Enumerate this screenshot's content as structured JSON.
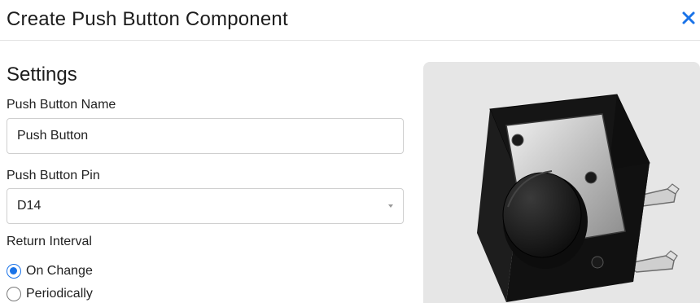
{
  "dialog": {
    "title": "Create Push Button Component",
    "close_icon": "close-icon"
  },
  "settings": {
    "heading": "Settings",
    "name_label": "Push Button Name",
    "name_value": "Push Button",
    "pin_label": "Push Button Pin",
    "pin_selected": "D14",
    "interval_label": "Return Interval",
    "interval_options": [
      {
        "label": "On Change",
        "checked": true
      },
      {
        "label": "Periodically",
        "checked": false
      }
    ]
  },
  "preview": {
    "image": "push-button-component-image"
  },
  "colors": {
    "accent": "#1a73e8",
    "close": "#1a73e8"
  }
}
